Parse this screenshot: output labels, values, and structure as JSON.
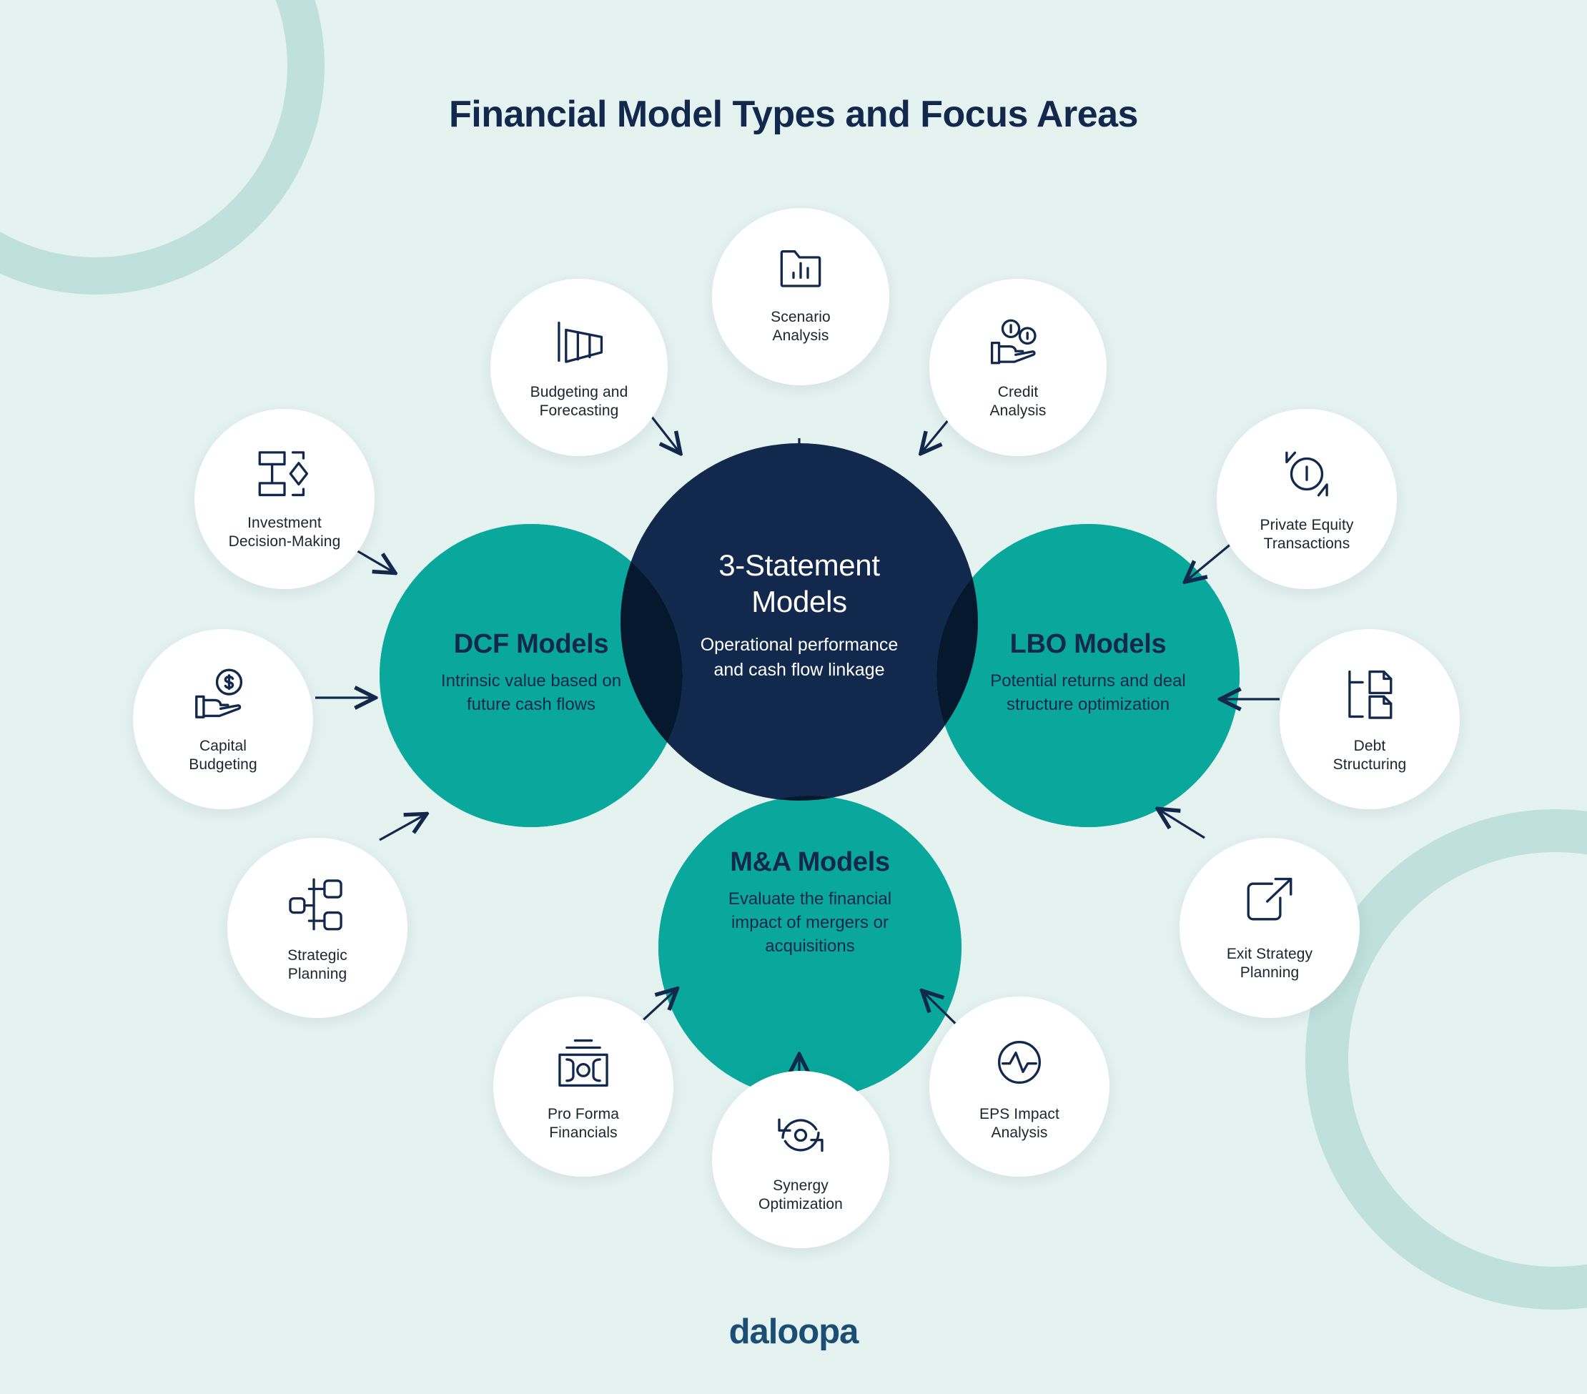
{
  "page": {
    "title": "Financial Model Types and Focus Areas",
    "brand": "daloopa",
    "background_color": "#e4f2f0",
    "accent_teal": "#0aa89c",
    "accent_navy": "#12284c",
    "decor_color": "#bfe0db"
  },
  "core": {
    "title": "3-Statement Models",
    "title_line1": "3-Statement",
    "title_line2": "Models",
    "subtitle": "Operational performance and cash flow linkage",
    "subtitle_line1": "Operational performance",
    "subtitle_line2": "and cash flow linkage",
    "color": "#12284c"
  },
  "models": [
    {
      "id": "dcf",
      "title": "DCF Models",
      "subtitle": "Intrinsic value based on future cash flows",
      "subtitle_line1": "Intrinsic value based on",
      "subtitle_line2": "future cash flows",
      "color": "#0aa89c"
    },
    {
      "id": "lbo",
      "title": "LBO Models",
      "subtitle": "Potential returns and deal structure optimization",
      "subtitle_line1": "Potential returns and deal",
      "subtitle_line2": "structure optimization",
      "color": "#0aa89c"
    },
    {
      "id": "ma",
      "title": "M&A Models",
      "subtitle": "Evaluate the financial impact of mergers or acquisitions",
      "subtitle_line1": "Evaluate the financial",
      "subtitle_line2": "impact of mergers or",
      "subtitle_line3": "acquisitions",
      "color": "#0aa89c"
    }
  ],
  "focus_areas": [
    {
      "id": "scenario-analysis",
      "label": "Scenario Analysis",
      "line1": "Scenario",
      "line2": "Analysis",
      "icon": "folder-bar-chart-icon",
      "connects_to": "3-Statement Models"
    },
    {
      "id": "budgeting-forecasting",
      "label": "Budgeting and Forecasting",
      "line1": "Budgeting and",
      "line2": "Forecasting",
      "icon": "forecast-funnel-icon",
      "connects_to": "3-Statement Models"
    },
    {
      "id": "credit-analysis",
      "label": "Credit Analysis",
      "line1": "Credit",
      "line2": "Analysis",
      "icon": "hand-coins-icon",
      "connects_to": "3-Statement Models"
    },
    {
      "id": "investment-decision",
      "label": "Investment Decision-Making",
      "line1": "Investment",
      "line2": "Decision-Making",
      "icon": "flowchart-decision-icon",
      "connects_to": "DCF Models"
    },
    {
      "id": "capital-budgeting",
      "label": "Capital Budgeting",
      "line1": "Capital",
      "line2": "Budgeting",
      "icon": "hand-dollar-coin-icon",
      "connects_to": "DCF Models"
    },
    {
      "id": "strategic-planning",
      "label": "Strategic Planning",
      "line1": "Strategic",
      "line2": "Planning",
      "icon": "org-chart-icon",
      "connects_to": "DCF Models"
    },
    {
      "id": "private-equity",
      "label": "Private Equity Transactions",
      "line1": "Private Equity",
      "line2": "Transactions",
      "icon": "exchange-circle-icon",
      "connects_to": "LBO Models"
    },
    {
      "id": "debt-structuring",
      "label": "Debt Structuring",
      "line1": "Debt",
      "line2": "Structuring",
      "icon": "document-tree-icon",
      "connects_to": "LBO Models"
    },
    {
      "id": "exit-strategy",
      "label": "Exit Strategy Planning",
      "line1": "Exit Strategy",
      "line2": "Planning",
      "icon": "external-link-icon",
      "connects_to": "LBO Models"
    },
    {
      "id": "pro-forma",
      "label": "Pro Forma Financials",
      "line1": "Pro Forma",
      "line2": "Financials",
      "icon": "banknote-icon",
      "connects_to": "M&A Models"
    },
    {
      "id": "synergy-optimization",
      "label": "Synergy Optimization",
      "line1": "Synergy",
      "line2": "Optimization",
      "icon": "refresh-cycle-icon",
      "connects_to": "M&A Models"
    },
    {
      "id": "eps-impact",
      "label": "EPS Impact Analysis",
      "line1": "EPS Impact",
      "line2": "Analysis",
      "icon": "pulse-circle-icon",
      "connects_to": "M&A Models"
    }
  ]
}
